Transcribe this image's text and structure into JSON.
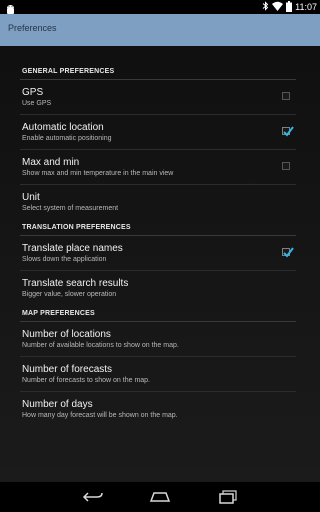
{
  "status_bar": {
    "time": "11:07",
    "icons": [
      "android-icon",
      "bluetooth-icon",
      "wifi-icon",
      "battery-icon"
    ]
  },
  "action_bar": {
    "title": "Preferences",
    "background": "#7e9ec2"
  },
  "accent_color": "#33b5e5",
  "sections": [
    {
      "header": "GENERAL PREFERENCES",
      "items": [
        {
          "title": "GPS",
          "summary": "Use GPS",
          "checkbox": true,
          "checked": false
        },
        {
          "title": "Automatic location",
          "summary": "Enable automatic positioning",
          "checkbox": true,
          "checked": true
        },
        {
          "title": "Max and min",
          "summary": "Show max and min temperature in the main view",
          "checkbox": true,
          "checked": false
        },
        {
          "title": "Unit",
          "summary": "Select system of measurement",
          "checkbox": false,
          "checked": false
        }
      ]
    },
    {
      "header": "TRANSLATION PREFERENCES",
      "items": [
        {
          "title": "Translate place names",
          "summary": "Slows down the application",
          "checkbox": true,
          "checked": true
        },
        {
          "title": "Translate search results",
          "summary": "Bigger value, slower operation",
          "checkbox": false,
          "checked": false
        }
      ]
    },
    {
      "header": "MAP PREFERENCES",
      "items": [
        {
          "title": "Number of locations",
          "summary": "Number of available locations to show on the map.",
          "checkbox": false,
          "checked": false
        },
        {
          "title": "Number of forecasts",
          "summary": "Number of forecasts to show on the map.",
          "checkbox": false,
          "checked": false
        },
        {
          "title": "Number of days",
          "summary": "How many day forecast will be shown on the map.",
          "checkbox": false,
          "checked": false
        }
      ]
    }
  ],
  "nav_bar": {
    "buttons": [
      "back-icon",
      "home-icon",
      "recent-apps-icon"
    ]
  }
}
